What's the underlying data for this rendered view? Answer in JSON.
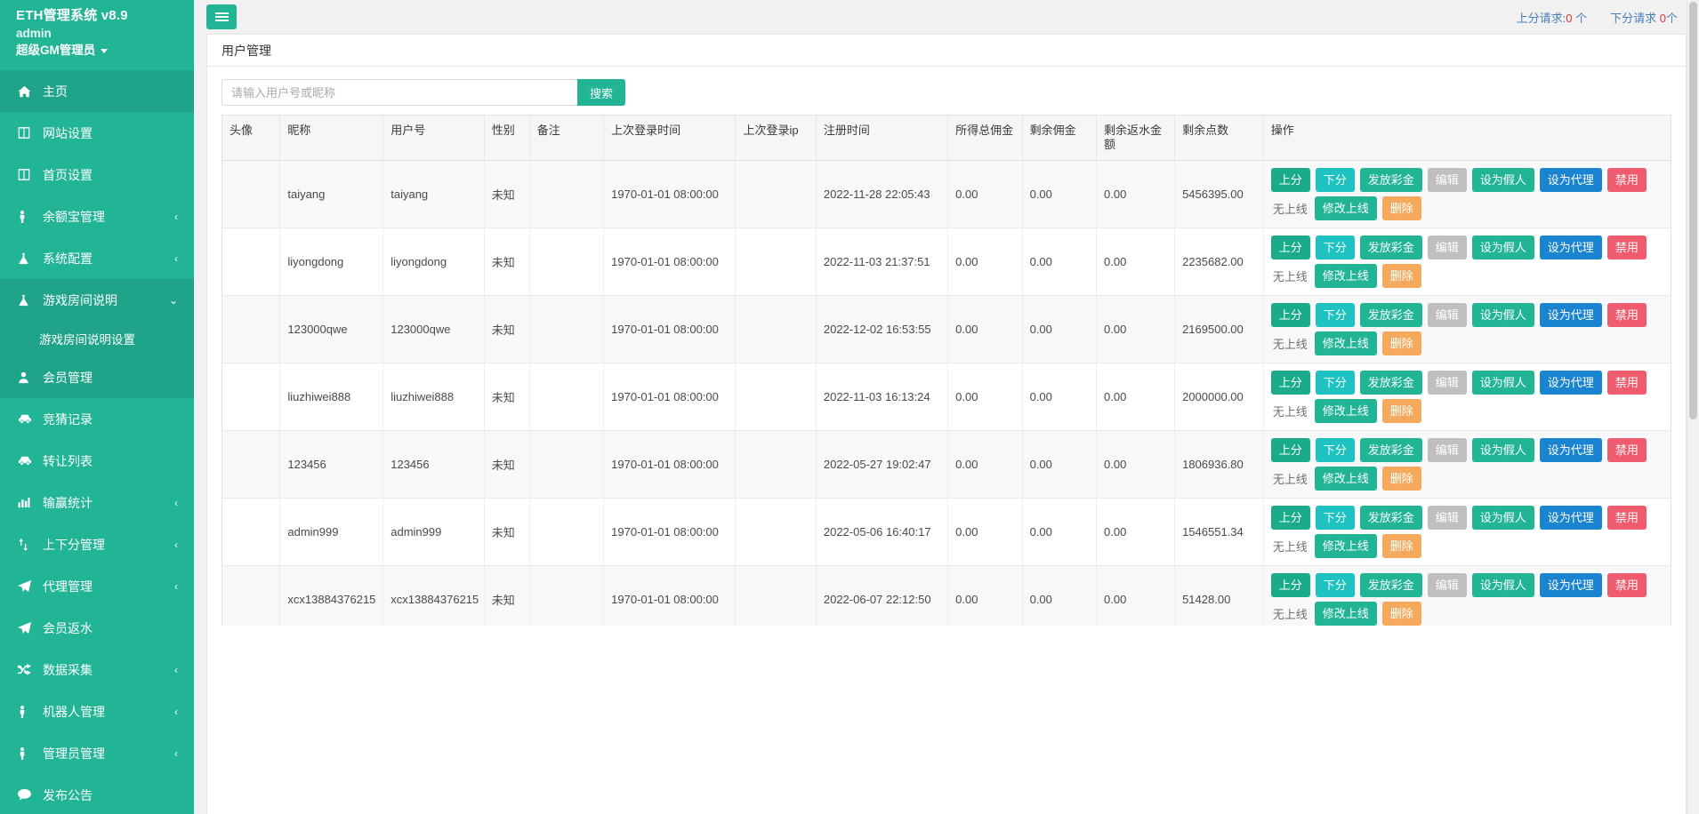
{
  "sidebar": {
    "brand_title": "ETH管理系统 v8.9",
    "user_name": "admin",
    "user_role": "超级GM管理员",
    "items": [
      {
        "label": "主页",
        "icon": "home-icon",
        "arrow": "",
        "active": true
      },
      {
        "label": "网站设置",
        "icon": "window-icon",
        "arrow": ""
      },
      {
        "label": "首页设置",
        "icon": "window-icon",
        "arrow": ""
      },
      {
        "label": "余额宝管理",
        "icon": "user-icon",
        "arrow": "‹"
      },
      {
        "label": "系统配置",
        "icon": "flask-icon",
        "arrow": "‹"
      },
      {
        "label": "游戏房间说明",
        "icon": "flask-icon",
        "arrow": "⌄",
        "open": true
      },
      {
        "label": "游戏房间说明设置",
        "icon": "",
        "arrow": "",
        "sub": true
      },
      {
        "label": "会员管理",
        "icon": "person-icon",
        "arrow": "",
        "active": true
      },
      {
        "label": "竞猜记录",
        "icon": "car-icon",
        "arrow": ""
      },
      {
        "label": "转让列表",
        "icon": "car-icon",
        "arrow": ""
      },
      {
        "label": "输赢统计",
        "icon": "chart-icon",
        "arrow": "‹"
      },
      {
        "label": "上下分管理",
        "icon": "arrows-icon",
        "arrow": "‹"
      },
      {
        "label": "代理管理",
        "icon": "send-icon",
        "arrow": "‹"
      },
      {
        "label": "会员返水",
        "icon": "send-icon",
        "arrow": ""
      },
      {
        "label": "数据采集",
        "icon": "shuffle-icon",
        "arrow": "‹"
      },
      {
        "label": "机器人管理",
        "icon": "user-icon",
        "arrow": "‹"
      },
      {
        "label": "管理员管理",
        "icon": "user-icon",
        "arrow": "‹"
      },
      {
        "label": "发布公告",
        "icon": "comment-icon",
        "arrow": ""
      }
    ]
  },
  "topbar": {
    "menu_toggle": "menu-icon",
    "up_request_label": "上分请求:",
    "up_request_count": "0",
    "up_request_unit": " 个",
    "down_request_label": "下分请求 ",
    "down_request_count": "0",
    "down_request_unit": "个"
  },
  "panel": {
    "title": "用户管理"
  },
  "search": {
    "placeholder": "请输入用户号或昵称",
    "value": "",
    "button_label": "搜索"
  },
  "table": {
    "columns": [
      "头像",
      "昵称",
      "用户号",
      "性别",
      "备注",
      "上次登录时间",
      "上次登录ip",
      "注册时间",
      "所得总佣金",
      "剩余佣金",
      "剩余返水金额",
      "剩余点数",
      "操作"
    ],
    "rows": [
      {
        "avatar": "",
        "nick": "taiyang",
        "uid": "taiyang",
        "sex": "未知",
        "note": "",
        "last_login": "1970-01-01 08:00:00",
        "last_ip": "",
        "reg_time": "2022-11-28 22:05:43",
        "total_commission": "0.00",
        "remain_commission": "0.00",
        "remain_rebate": "0.00",
        "remain_points": "5456395.00"
      },
      {
        "avatar": "",
        "nick": "liyongdong",
        "uid": "liyongdong",
        "sex": "未知",
        "note": "",
        "last_login": "1970-01-01 08:00:00",
        "last_ip": "",
        "reg_time": "2022-11-03 21:37:51",
        "total_commission": "0.00",
        "remain_commission": "0.00",
        "remain_rebate": "0.00",
        "remain_points": "2235682.00"
      },
      {
        "avatar": "",
        "nick": "123000qwe",
        "uid": "123000qwe",
        "sex": "未知",
        "note": "",
        "last_login": "1970-01-01 08:00:00",
        "last_ip": "",
        "reg_time": "2022-12-02 16:53:55",
        "total_commission": "0.00",
        "remain_commission": "0.00",
        "remain_rebate": "0.00",
        "remain_points": "2169500.00"
      },
      {
        "avatar": "",
        "nick": "liuzhiwei888",
        "uid": "liuzhiwei888",
        "sex": "未知",
        "note": "",
        "last_login": "1970-01-01 08:00:00",
        "last_ip": "",
        "reg_time": "2022-11-03 16:13:24",
        "total_commission": "0.00",
        "remain_commission": "0.00",
        "remain_rebate": "0.00",
        "remain_points": "2000000.00"
      },
      {
        "avatar": "",
        "nick": "123456",
        "uid": "123456",
        "sex": "未知",
        "note": "",
        "last_login": "1970-01-01 08:00:00",
        "last_ip": "",
        "reg_time": "2022-05-27 19:02:47",
        "total_commission": "0.00",
        "remain_commission": "0.00",
        "remain_rebate": "0.00",
        "remain_points": "1806936.80"
      },
      {
        "avatar": "",
        "nick": "admin999",
        "uid": "admin999",
        "sex": "未知",
        "note": "",
        "last_login": "1970-01-01 08:00:00",
        "last_ip": "",
        "reg_time": "2022-05-06 16:40:17",
        "total_commission": "0.00",
        "remain_commission": "0.00",
        "remain_rebate": "0.00",
        "remain_points": "1546551.34"
      },
      {
        "avatar": "",
        "nick": "xcx13884376215",
        "uid": "xcx13884376215",
        "sex": "未知",
        "note": "",
        "last_login": "1970-01-01 08:00:00",
        "last_ip": "",
        "reg_time": "2022-06-07 22:12:50",
        "total_commission": "0.00",
        "remain_commission": "0.00",
        "remain_rebate": "0.00",
        "remain_points": "51428.00"
      }
    ],
    "row_actions": [
      {
        "label": "上分",
        "style": "btn-teal"
      },
      {
        "label": "下分",
        "style": "btn-cyan"
      },
      {
        "label": "发放彩金",
        "style": "btn-green"
      },
      {
        "label": "编辑",
        "style": "btn-grey"
      },
      {
        "label": "设为假人",
        "style": "btn-green"
      },
      {
        "label": "设为代理",
        "style": "btn-blue"
      },
      {
        "label": "禁用",
        "style": "btn-red"
      },
      {
        "label": "无上线",
        "style": "plain"
      },
      {
        "label": "修改上线",
        "style": "btn-green"
      },
      {
        "label": "删除",
        "style": "btn-orange"
      }
    ]
  },
  "colors": {
    "brand": "#21b495",
    "sidebar_active": "#1fa489",
    "link_blue": "#4a7ebb",
    "alert_red": "#e8343a"
  }
}
